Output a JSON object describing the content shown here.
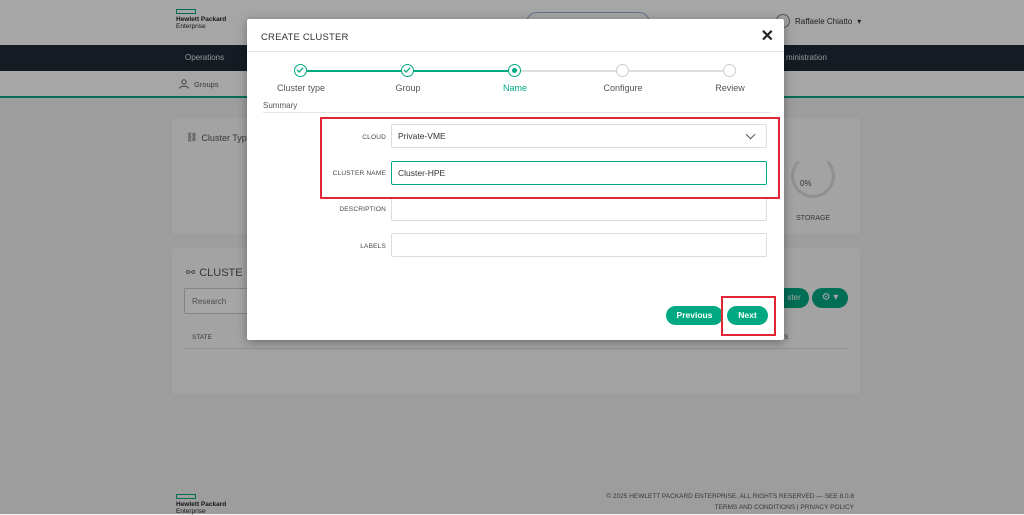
{
  "app": {
    "brand_line1": "Hewlett Packard",
    "brand_line2": "Enterprise",
    "user_name": "Raffaele Chiatto",
    "nav": {
      "operations": "Operations",
      "administration": "ministration"
    },
    "subnav": {
      "groups": "Groups"
    },
    "cards": {
      "cluster_types_title": "Cluster Typ",
      "storage_pct": "0%",
      "storage_label": "STORAGE",
      "clusters_title": "CLUSTE",
      "search_placeholder": "Research",
      "state_col": "STATE",
      "last_col": "S",
      "add_cluster_btn": "ster",
      "gear_btn": "⚙ ▾"
    },
    "footer": {
      "copyright": "© 2025 HEWLETT PACKARD ENTERPRISE. ALL RIGHTS RESERVED — SEE 8.0.8",
      "links": "TERMS AND CONDITIONS  |  PRIVACY POLICY"
    }
  },
  "modal": {
    "title": "CREATE CLUSTER",
    "close_symbol": "✕",
    "steps": [
      {
        "label": "Cluster type",
        "state": "done"
      },
      {
        "label": "Group",
        "state": "done"
      },
      {
        "label": "Name",
        "state": "active"
      },
      {
        "label": "Configure",
        "state": "pending"
      },
      {
        "label": "Review",
        "state": "pending"
      }
    ],
    "summary_label": "Summary",
    "form": {
      "cloud_label": "CLOUD",
      "cloud_value": "Private-VME",
      "cluster_name_label": "CLUSTER NAME",
      "cluster_name_value": "Cluster-HPE",
      "description_label": "DESCRIPTION",
      "description_value": "",
      "labels_label": "LABELS",
      "labels_value": ""
    },
    "buttons": {
      "previous": "Previous",
      "next": "Next"
    }
  },
  "colors": {
    "accent": "#01a982",
    "highlight": "#e32636",
    "navbar": "#1f2a36"
  }
}
